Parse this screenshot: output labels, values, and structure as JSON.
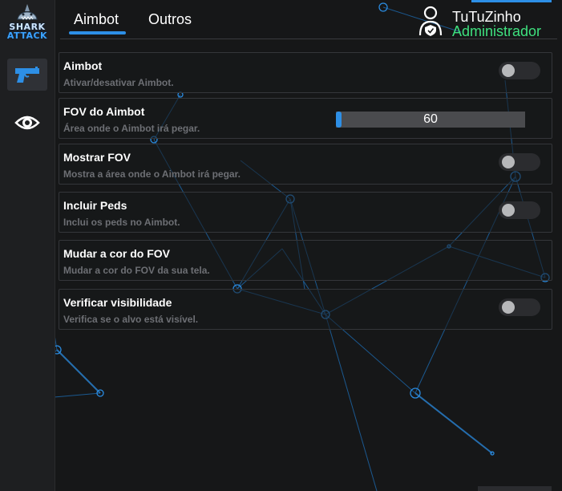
{
  "logo": {
    "line1": "SHARK",
    "line2": "ATTACK"
  },
  "sidebar": {
    "items": [
      {
        "icon": "pistol-icon",
        "active": true
      },
      {
        "icon": "eye-icon",
        "active": false
      }
    ]
  },
  "tabs": [
    {
      "label": "Aimbot",
      "active": true
    },
    {
      "label": "Outros",
      "active": false
    }
  ],
  "user": {
    "name": "TuTuZinho",
    "role": "Administrador",
    "icon": "user-shield-icon"
  },
  "settings": [
    {
      "title": "Aimbot",
      "description": "Ativar/desativar Aimbot.",
      "control": "toggle",
      "on": false
    },
    {
      "title": "FOV do Aimbot",
      "description": "Área onde o Aimbot irá pegar.",
      "control": "slider",
      "value": "60",
      "fill_fraction": 0.03
    },
    {
      "title": "Mostrar FOV",
      "description": "Mostra a área onde o Aimbot irá pegar.",
      "control": "toggle",
      "on": false
    },
    {
      "title": "Incluir Peds",
      "description": "Inclui os peds no Aimbot.",
      "control": "toggle",
      "on": false
    },
    {
      "title": "Mudar a cor do FOV",
      "description": "Mudar a cor do FOV da sua tela.",
      "control": "none"
    },
    {
      "title": "Verificar visibilidade",
      "description": "Verifica se o alvo está visível.",
      "control": "toggle",
      "on": false
    }
  ],
  "colors": {
    "accent": "#2d8fe6",
    "role": "#3ee07e",
    "background": "#161718"
  }
}
